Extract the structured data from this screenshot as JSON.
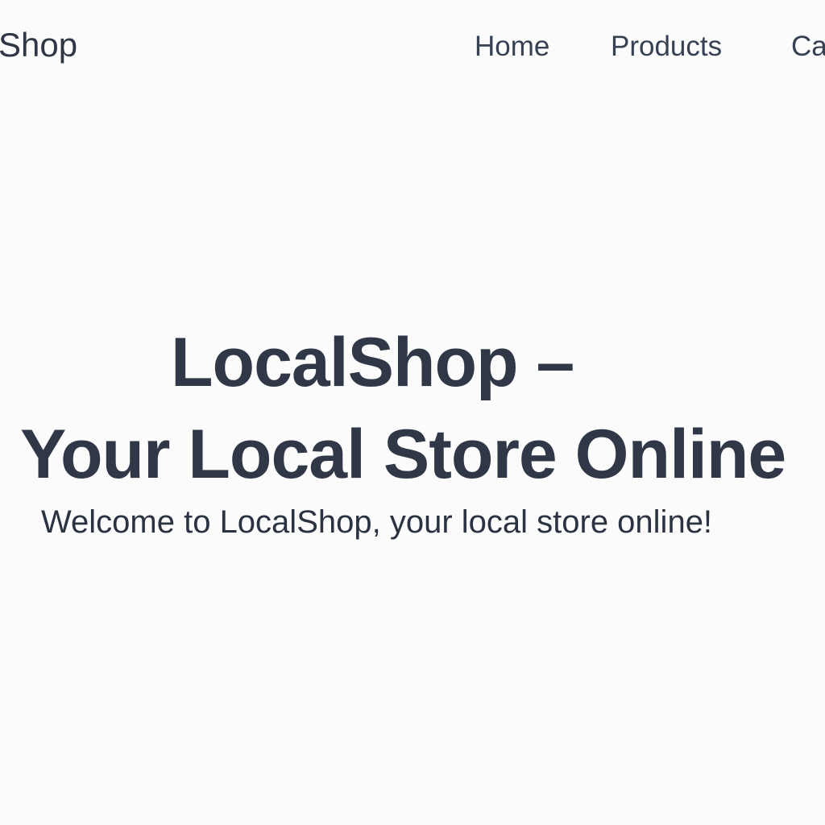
{
  "header": {
    "brand": "Shop",
    "nav": {
      "home": "Home",
      "products": "Products",
      "cart_partial": "Ca"
    }
  },
  "hero": {
    "title_line1": "LocalShop –",
    "title_line2": "Your Local Store Online",
    "subtitle": "Welcome to LocalShop, your local store online!"
  },
  "colors": {
    "background": "#fbfbfb",
    "text": "#2f3746"
  }
}
